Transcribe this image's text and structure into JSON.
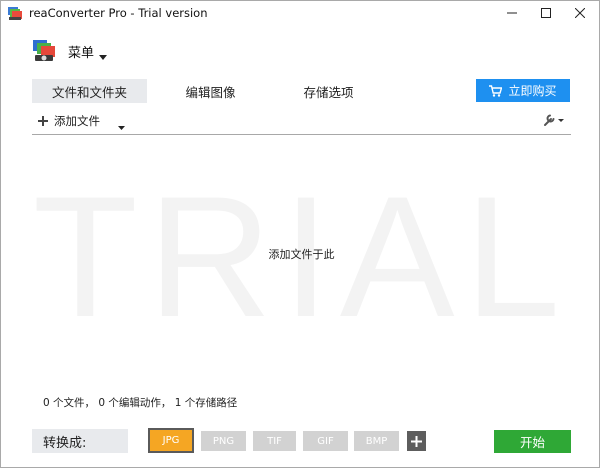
{
  "window": {
    "title": "reaConverter Pro - Trial version"
  },
  "menu": {
    "label": "菜单"
  },
  "tabs": [
    {
      "label": "文件和文件夹",
      "active": true
    },
    {
      "label": "编辑图像",
      "active": false
    },
    {
      "label": "存储选项",
      "active": false
    }
  ],
  "buy": {
    "label": "立即购买",
    "color": "#1e90f0"
  },
  "toolbar": {
    "add_files_label": "添加文件"
  },
  "drop_area": {
    "watermark": "TRIAL",
    "hint": "添加文件于此"
  },
  "status": {
    "text": "0 个文件， 0 个编辑动作， 1 个存储路径"
  },
  "convert": {
    "label": "转换成:",
    "formats": [
      {
        "label": "JPG",
        "selected": true
      },
      {
        "label": "PNG",
        "selected": false
      },
      {
        "label": "TIF",
        "selected": false
      },
      {
        "label": "GIF",
        "selected": false
      },
      {
        "label": "BMP",
        "selected": false
      }
    ],
    "selected_color": "#f5a623"
  },
  "start": {
    "label": "开始",
    "color": "#2fa836"
  },
  "icons": {
    "app": "app-icon",
    "minimize": "minimize-icon",
    "maximize": "maximize-icon",
    "close": "close-icon",
    "menu_logo": "reaconverter-logo-icon",
    "cart": "cart-icon",
    "plus": "plus-icon",
    "wrench": "wrench-icon"
  }
}
